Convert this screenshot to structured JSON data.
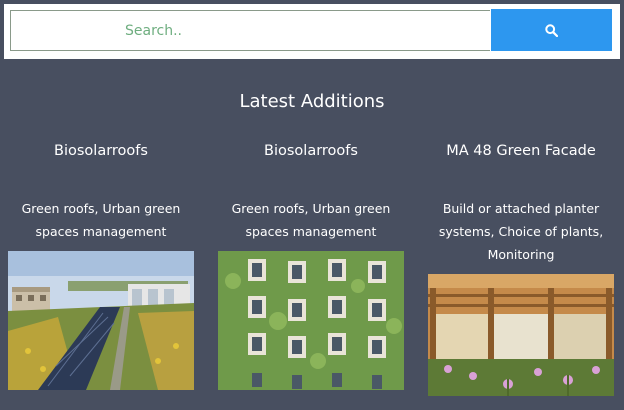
{
  "search": {
    "placeholder": "Search..",
    "button_icon": "search-icon"
  },
  "section": {
    "title": "Latest Additions"
  },
  "cards": [
    {
      "title": "Biosolarroofs",
      "description": "Green roofs, Urban green spaces management",
      "image": "green-roof-solar-panels-photo"
    },
    {
      "title": "Biosolarroofs",
      "description": "Green roofs, Urban green spaces management",
      "image": "green-facade-building-photo"
    },
    {
      "title": "MA 48 Green Facade",
      "description": "Build or attached planter systems, Choice of plants, Monitoring",
      "image": "wooden-pergola-garden-photo"
    }
  ],
  "colors": {
    "background": "#484f60",
    "search_button": "#2d97ef",
    "placeholder": "#6fae80"
  }
}
